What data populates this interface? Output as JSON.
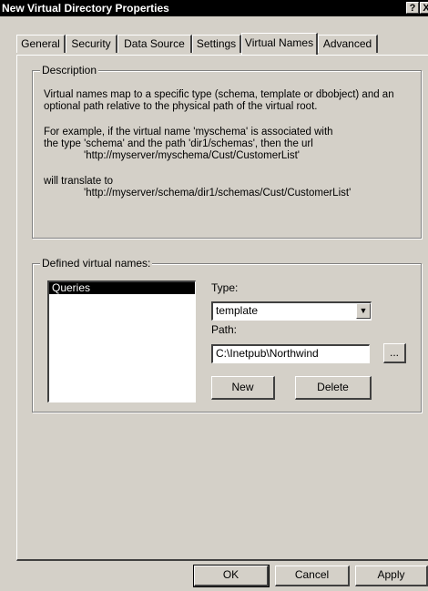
{
  "window": {
    "title": "New Virtual Directory Properties",
    "help_btn": "?",
    "close_btn": "X"
  },
  "tabs": [
    {
      "label": "General"
    },
    {
      "label": "Security"
    },
    {
      "label": "Data Source"
    },
    {
      "label": "Settings"
    },
    {
      "label": "Virtual Names",
      "active": true
    },
    {
      "label": "Advanced"
    }
  ],
  "description": {
    "legend": "Description",
    "line1": "Virtual names map to a specific type (schema, template or dbobject) and an",
    "line2": "optional path relative to the physical path of the virtual root.",
    "line3": "For example, if the virtual name 'myschema' is associated with",
    "line4": "the type 'schema' and the path 'dir1/schemas', then the url",
    "line5": "'http://myserver/myschema/Cust/CustomerList'",
    "line6": "will translate to",
    "line7": "'http://myserver/schema/dir1/schemas/Cust/CustomerList'"
  },
  "defined": {
    "legend": "Defined virtual names:",
    "items": [
      "Queries"
    ],
    "type_label": "Type:",
    "type_value": "template",
    "path_label": "Path:",
    "path_value": "C:\\Inetpub\\Northwind",
    "browse_label": "...",
    "new_label": "New",
    "delete_label": "Delete"
  },
  "footer": {
    "ok_label": "OK",
    "cancel_label": "Cancel",
    "apply_label": "Apply"
  }
}
